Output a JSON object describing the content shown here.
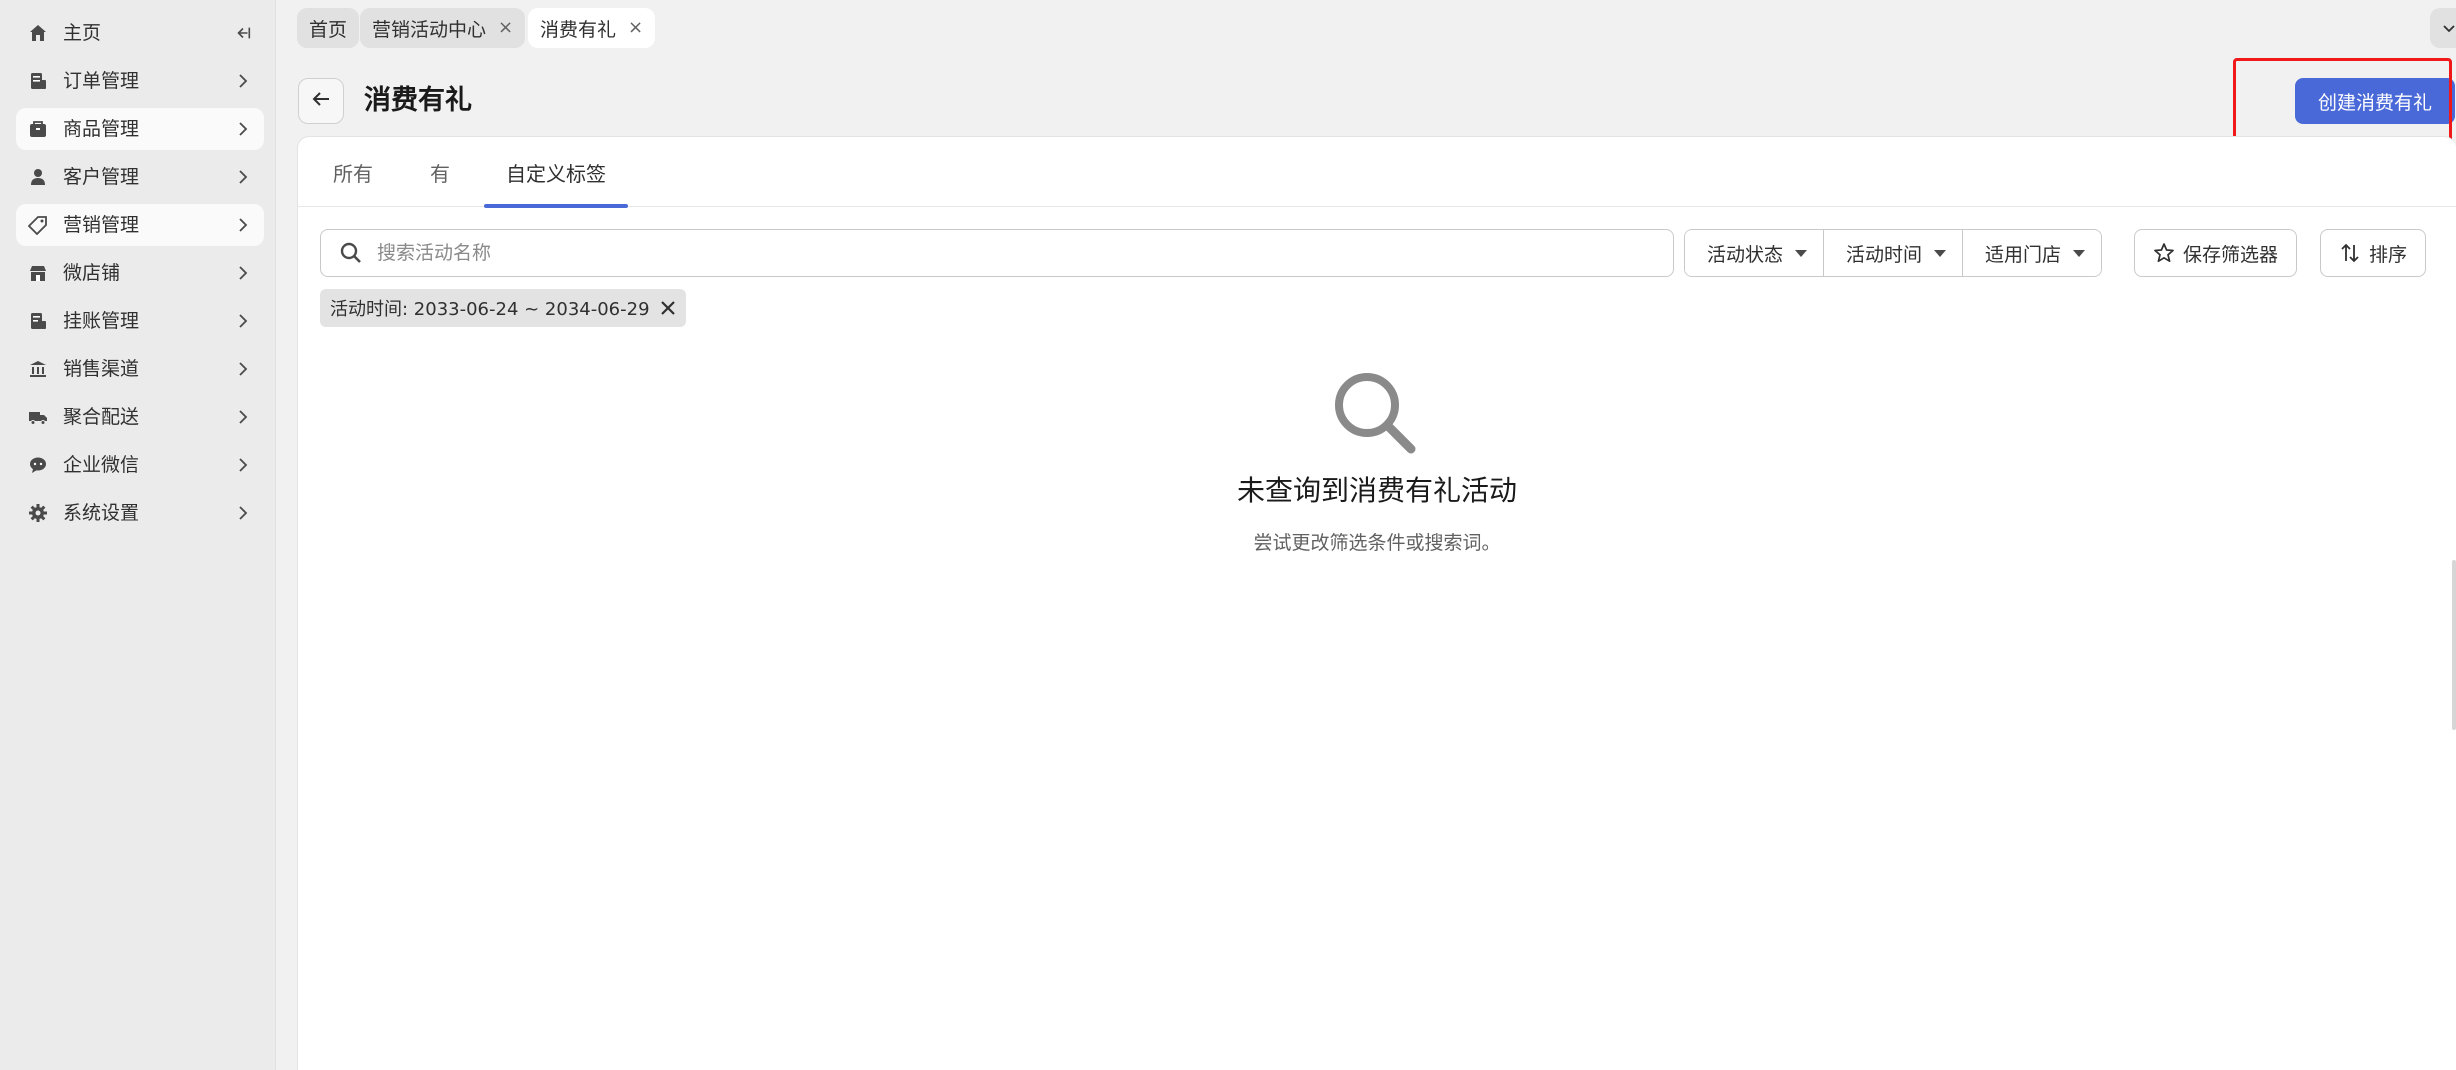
{
  "sidebar": {
    "collapse_icon": "collapse-left-icon",
    "items": [
      {
        "label": "主页",
        "icon": "home-icon",
        "has_chevron": false,
        "active": false
      },
      {
        "label": "订单管理",
        "icon": "orders-icon",
        "has_chevron": true,
        "active": false
      },
      {
        "label": "商品管理",
        "icon": "products-icon",
        "has_chevron": true,
        "active": true
      },
      {
        "label": "客户管理",
        "icon": "customer-icon",
        "has_chevron": true,
        "active": false
      },
      {
        "label": "营销管理",
        "icon": "tag-icon",
        "has_chevron": true,
        "active": true
      },
      {
        "label": "微店铺",
        "icon": "store-icon",
        "has_chevron": true,
        "active": false
      },
      {
        "label": "挂账管理",
        "icon": "ledger-icon",
        "has_chevron": true,
        "active": false
      },
      {
        "label": "销售渠道",
        "icon": "bank-icon",
        "has_chevron": true,
        "active": false
      },
      {
        "label": "聚合配送",
        "icon": "truck-icon",
        "has_chevron": true,
        "active": false
      },
      {
        "label": "企业微信",
        "icon": "chat-icon",
        "has_chevron": true,
        "active": false
      },
      {
        "label": "系统设置",
        "icon": "gear-icon",
        "has_chevron": true,
        "active": false
      }
    ]
  },
  "top_tabs": [
    {
      "label": "首页",
      "closable": false,
      "active": false
    },
    {
      "label": "营销活动中心",
      "closable": true,
      "active": false
    },
    {
      "label": "消费有礼",
      "closable": true,
      "active": true
    }
  ],
  "header": {
    "title": "消费有礼",
    "primary_button": "创建消费有礼"
  },
  "content_tabs": [
    {
      "label": "所有",
      "active": false
    },
    {
      "label": "有",
      "active": false
    },
    {
      "label": "自定义标签",
      "active": true
    }
  ],
  "search": {
    "placeholder": "搜索活动名称",
    "value": ""
  },
  "filters": [
    "活动状态",
    "活动时间",
    "适用门店"
  ],
  "actions": {
    "save_filter": "保存筛选器",
    "sort": "排序"
  },
  "applied_filter_chip": "活动时间: 2033-06-24 ~ 2034-06-29",
  "empty_state": {
    "title": "未查询到消费有礼活动",
    "subtitle": "尝试更改筛选条件或搜索词。"
  },
  "colors": {
    "primary": "#4a69d8",
    "highlight": "#f01818"
  }
}
